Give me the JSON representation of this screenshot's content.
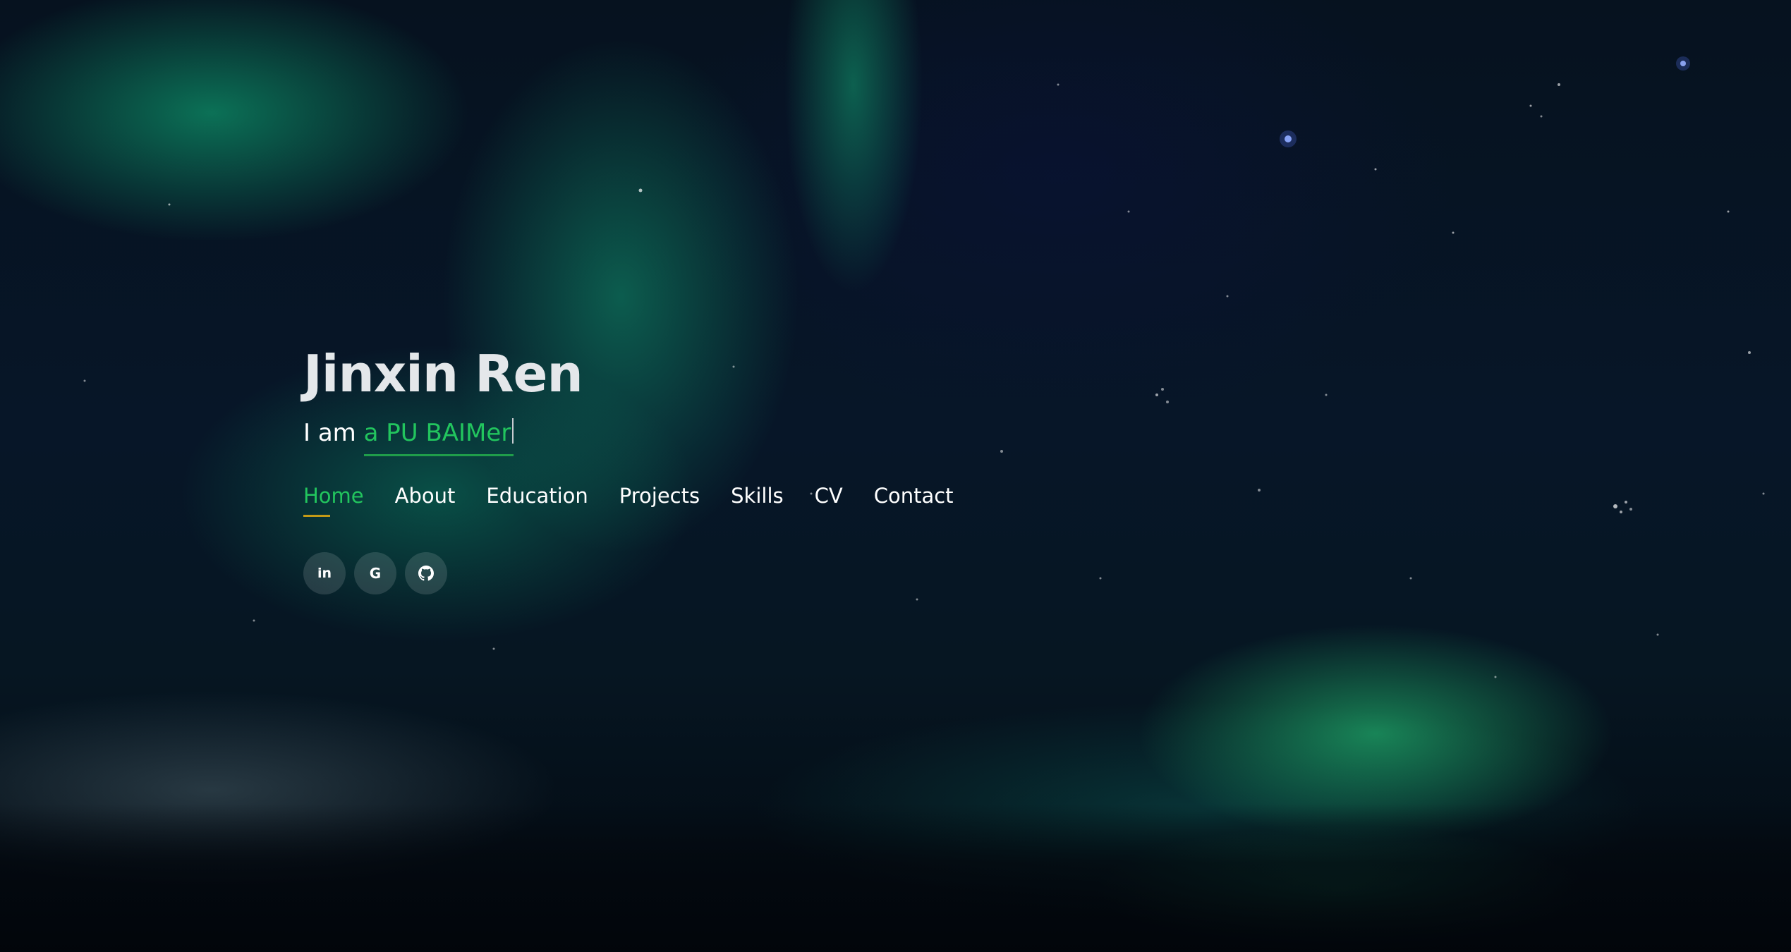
{
  "hero": {
    "name": "Jinxin Ren",
    "tagline_prefix": "I am",
    "tagline_typed": "a PU BAIMer"
  },
  "nav": {
    "items": [
      {
        "label": "Home",
        "active": true
      },
      {
        "label": "About",
        "active": false
      },
      {
        "label": "Education",
        "active": false
      },
      {
        "label": "Projects",
        "active": false
      },
      {
        "label": "Skills",
        "active": false
      },
      {
        "label": "CV",
        "active": false
      },
      {
        "label": "Contact",
        "active": false
      }
    ]
  },
  "social": {
    "linkedin_text": "in",
    "google_text": "G",
    "icons": [
      "linkedin-icon",
      "google-icon",
      "github-icon"
    ]
  },
  "colors": {
    "accent": "#22c55e",
    "nav_underline": "#c49a16",
    "text": "#ffffff",
    "name_text": "#e4e7ea"
  }
}
